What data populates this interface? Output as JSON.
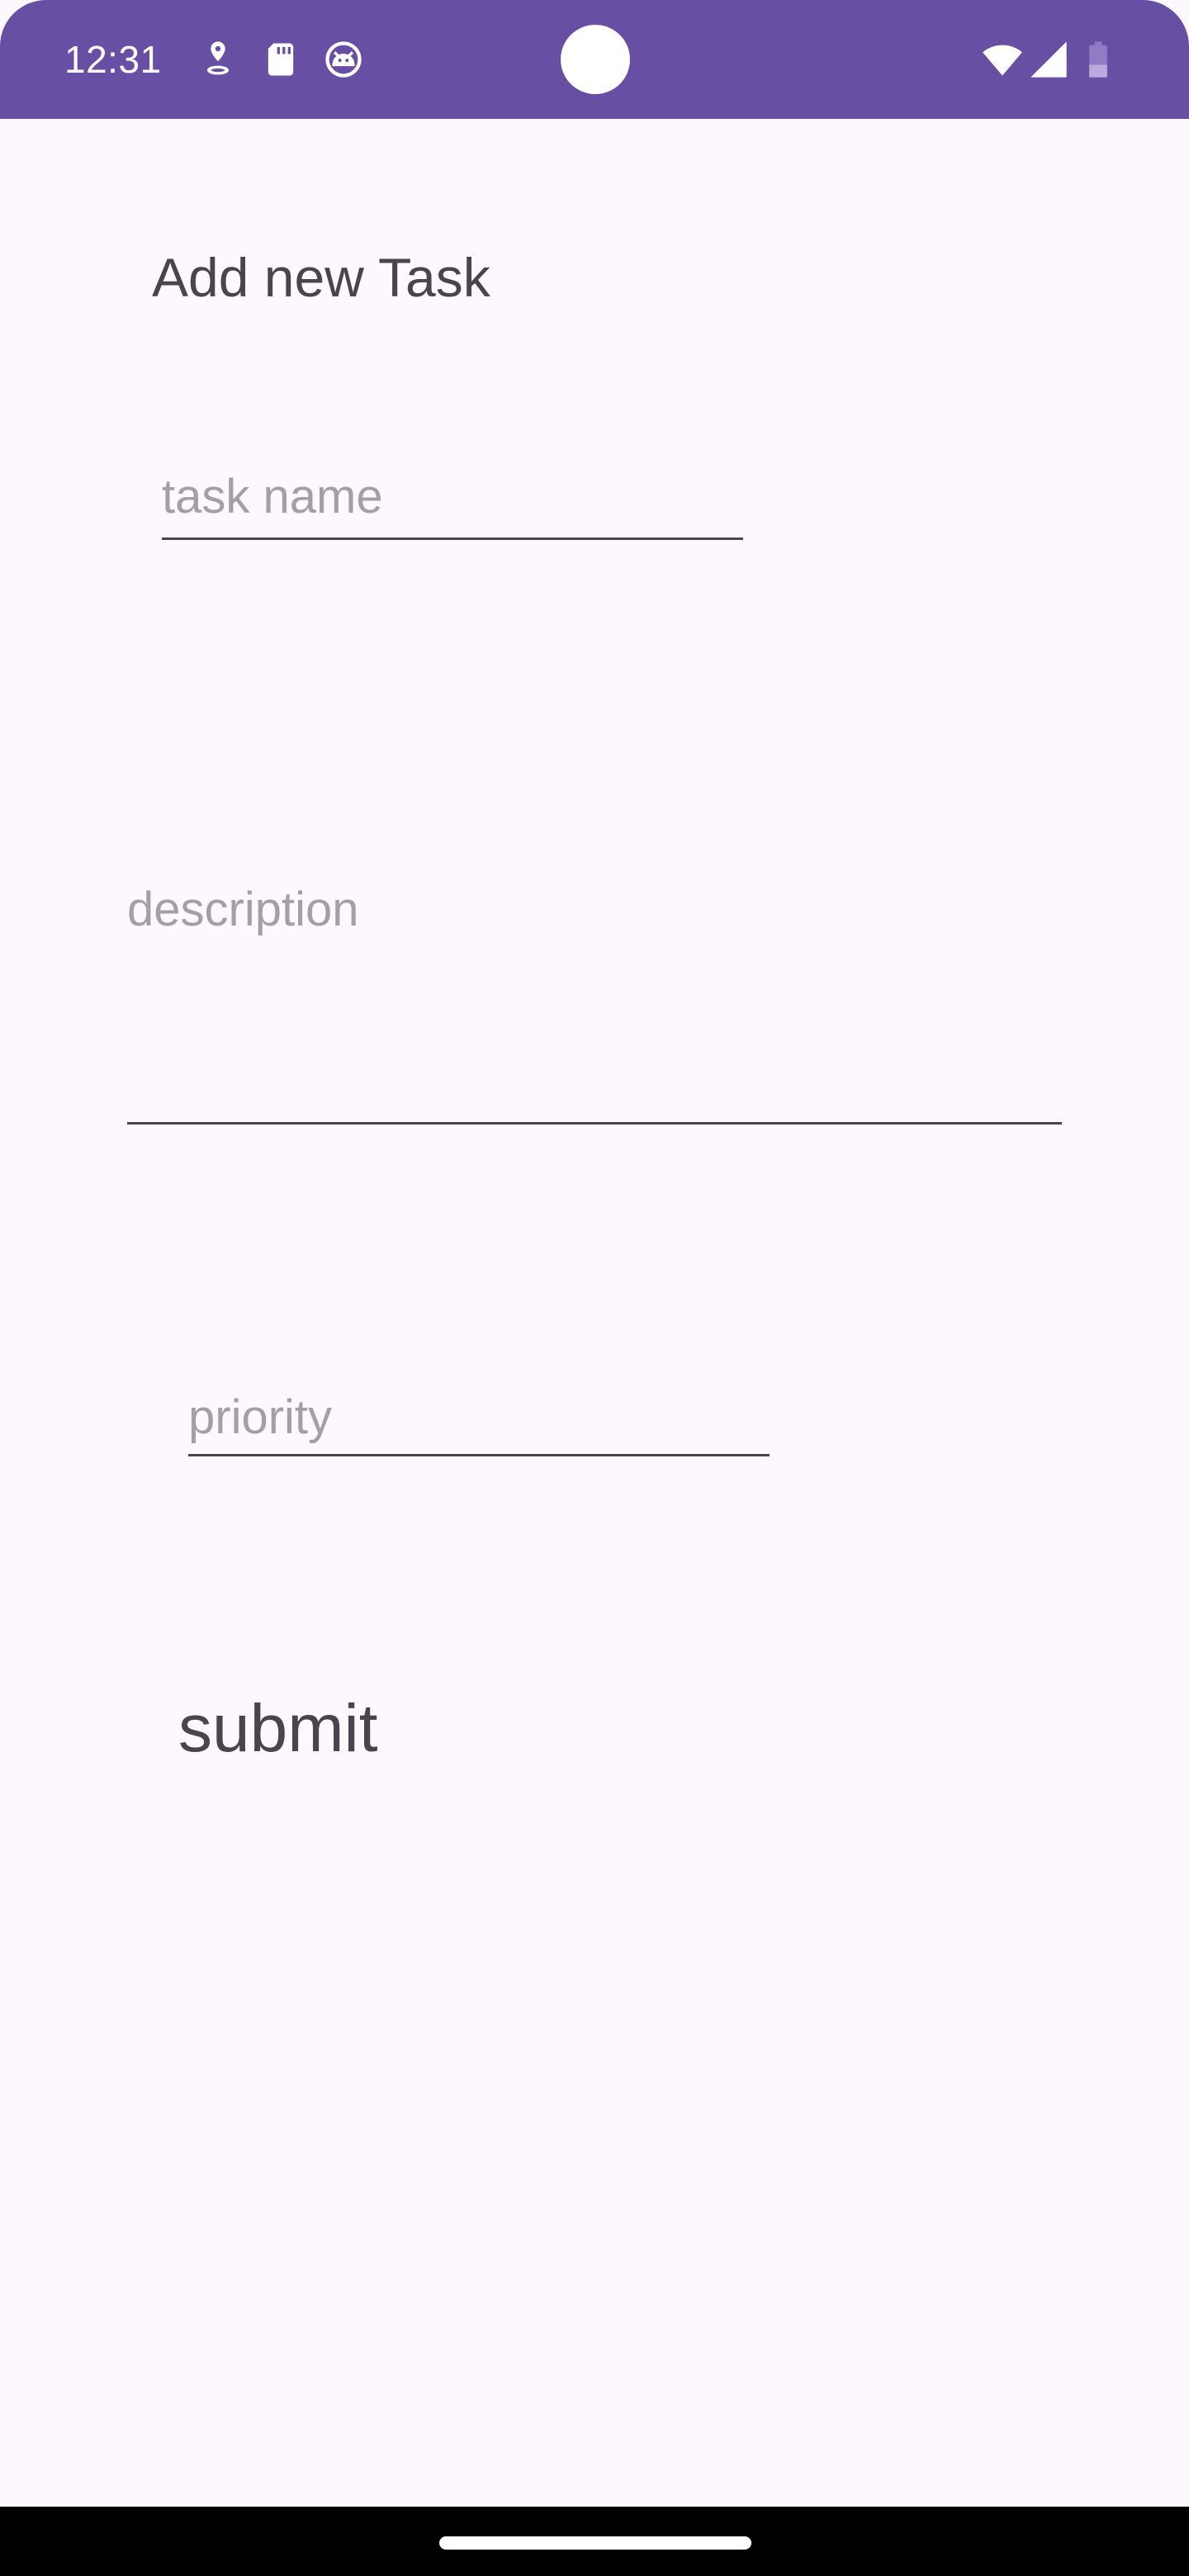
{
  "status_bar": {
    "time": "12:31",
    "background": "#6750a4",
    "left_icons": [
      "location-pin-icon",
      "sd-card-icon",
      "android-debug-icon"
    ],
    "right_icons": [
      "wifi-icon",
      "cell-signal-icon",
      "battery-icon"
    ]
  },
  "form": {
    "title": "Add new Task",
    "task_name": {
      "placeholder": "task name",
      "value": ""
    },
    "description": {
      "placeholder": "description",
      "value": ""
    },
    "priority": {
      "placeholder": "priority",
      "value": ""
    },
    "submit_label": "submit"
  },
  "colors": {
    "background": "#fdf7fe",
    "text": "#49454f",
    "placeholder": "#a29fa6",
    "accent": "#6750a4"
  }
}
